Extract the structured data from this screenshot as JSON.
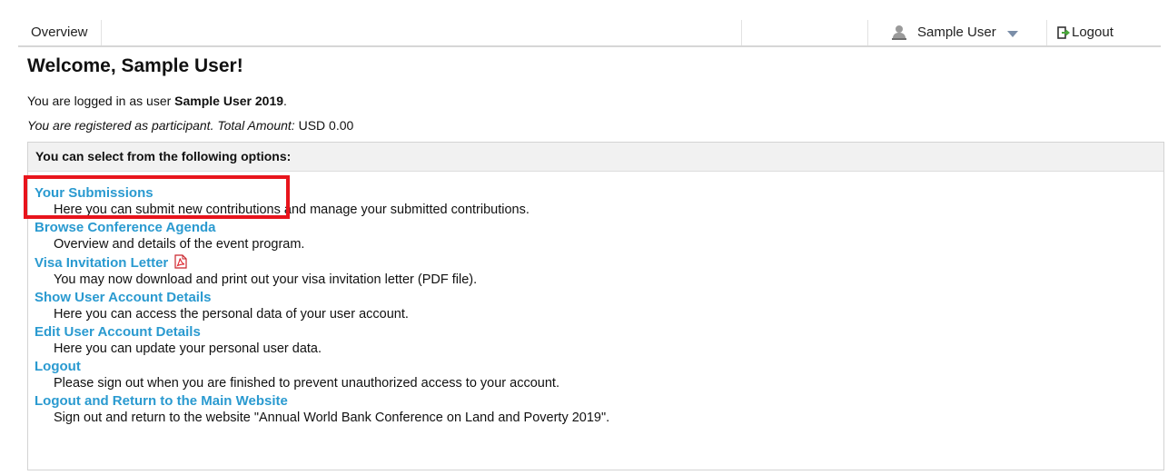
{
  "nav": {
    "overview": "Overview",
    "user_name": "Sample User",
    "logout": "Logout"
  },
  "welcome": {
    "title": "Welcome, Sample User!",
    "login_prefix": "You are logged in as user ",
    "login_user": "Sample User 2019",
    "login_suffix": ".",
    "reg_text": "You are registered as participant. Total Amount:",
    "reg_amount": " USD 0.00"
  },
  "options": {
    "header": "You can select from the following options:",
    "items": [
      {
        "label": "Your Submissions",
        "desc": "Here you can submit new contributions and manage your submitted contributions."
      },
      {
        "label": "Browse Conference Agenda",
        "desc": "Overview and details of the event program."
      },
      {
        "label": "Visa Invitation Letter",
        "desc": "You may now download and print out your visa invitation letter (PDF file)."
      },
      {
        "label": "Show User Account Details",
        "desc": "Here you can access the personal data of your user account."
      },
      {
        "label": "Edit User Account Details",
        "desc": "Here you can update your personal user data."
      },
      {
        "label": "Logout",
        "desc": "Please sign out when you are finished to prevent unauthorized access to your account."
      },
      {
        "label": "Logout and Return to the Main Website",
        "desc": "Sign out and return to the website \"Annual World Bank Conference on Land and Poverty 2019\"."
      }
    ]
  },
  "colors": {
    "link": "#2a9ad0",
    "highlight": "#e8141c",
    "header_bg": "#f1f1f1"
  },
  "icons": {
    "user": "user-icon",
    "caret": "caret-down-icon",
    "logout": "logout-icon",
    "pdf": "pdf-icon"
  }
}
